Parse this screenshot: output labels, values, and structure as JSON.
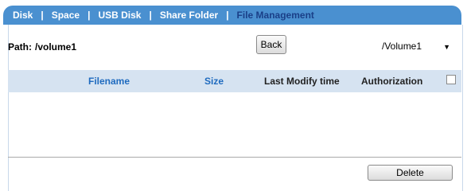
{
  "tabs": [
    {
      "label": "Disk"
    },
    {
      "label": "Space"
    },
    {
      "label": "USB Disk"
    },
    {
      "label": "Share Folder"
    },
    {
      "label": "File Management",
      "active": true
    }
  ],
  "tab_separator": "|",
  "path": {
    "label": "Path:",
    "value": "/volume1"
  },
  "back_label": "Back",
  "volume_select": {
    "value": "/Volume1"
  },
  "table": {
    "columns": [
      "Filename",
      "Size",
      "Last Modify time",
      "Authorization"
    ],
    "rows": []
  },
  "delete_label": "Delete",
  "colors": {
    "tab_bar": "#4a90d0",
    "active_tab_text": "#1a3f88",
    "header_bg": "#d6e3f1",
    "link_text": "#1f6bbf"
  }
}
